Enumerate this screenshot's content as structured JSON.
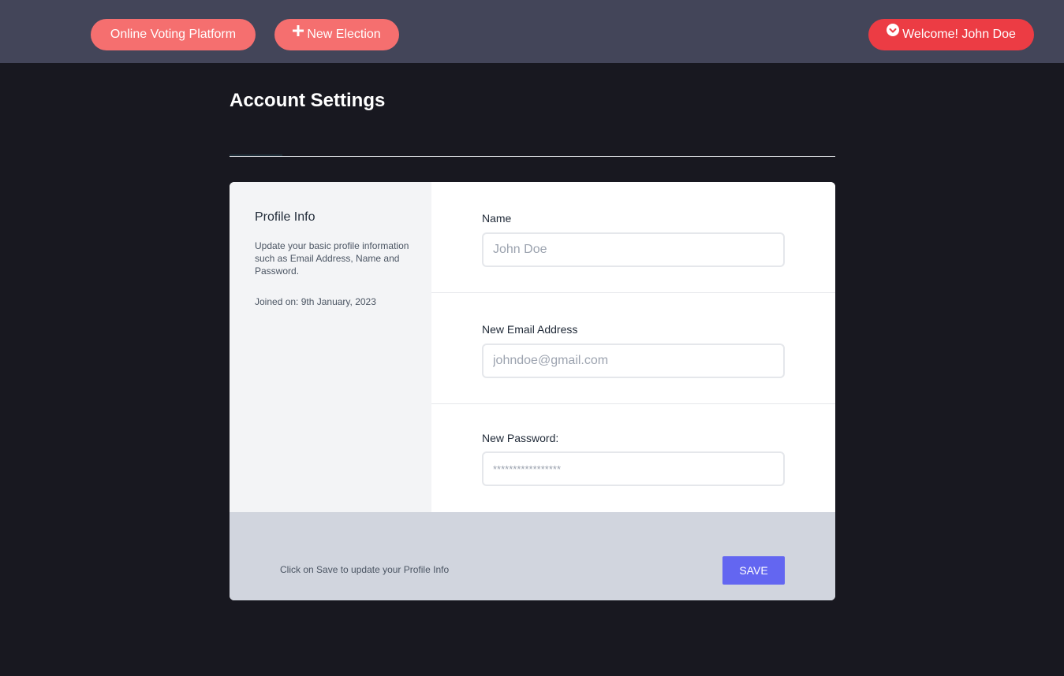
{
  "header": {
    "brand_label": "Online Voting Platform",
    "new_election_label": "New Election",
    "welcome_label": "Welcome! John Doe",
    "plus_icon": "plus-icon",
    "user_icon": "check-circle-icon"
  },
  "page": {
    "title": "Account Settings"
  },
  "profile": {
    "title": "Profile Info",
    "description": "Update your basic profile information such as Email Address, Name and Password.",
    "joined": "Joined on: 9th January, 2023"
  },
  "form": {
    "name_label": "Name",
    "name_placeholder": "John Doe",
    "email_label": "New Email Address",
    "email_placeholder": "johndoe@gmail.com",
    "password_label": "New Password:",
    "password_placeholder": "*****************"
  },
  "footer": {
    "note": "Click on Save to update your Profile Info",
    "save_label": "SAVE"
  },
  "colors": {
    "topbar": "#434559",
    "background": "#181820",
    "pill": "#f56f6f",
    "welcome_pill": "#ec3c44",
    "save_button": "#6366f1"
  }
}
